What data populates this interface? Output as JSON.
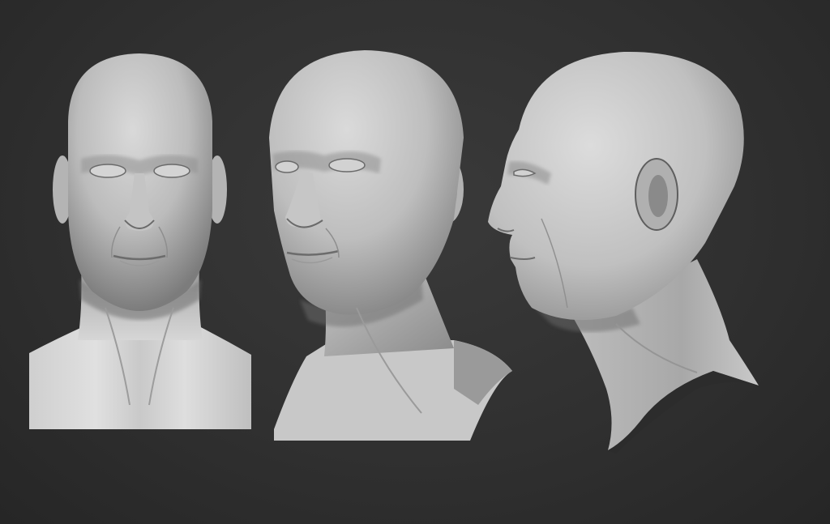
{
  "scene": {
    "background_color": "#2e2e2e",
    "material_color": "#bdbdbd",
    "views": [
      {
        "name": "front",
        "label": ""
      },
      {
        "name": "three-quarter",
        "label": ""
      },
      {
        "name": "profile",
        "label": ""
      }
    ]
  }
}
